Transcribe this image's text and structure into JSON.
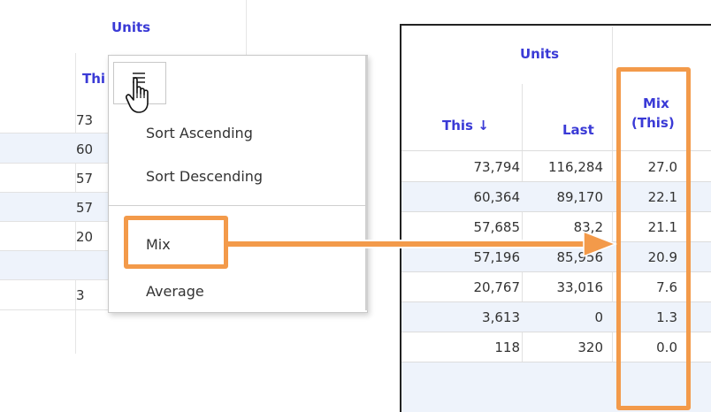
{
  "left_table": {
    "header_units": "Units",
    "header_this": "Thi",
    "rows": [
      "73",
      "60",
      "57",
      "57",
      "20",
      "3"
    ]
  },
  "menu": {
    "icon": "hamburger-icon",
    "items": {
      "sort_asc": "Sort Ascending",
      "sort_desc": "Sort Descending",
      "mix": "Mix",
      "average": "Average"
    }
  },
  "right_table": {
    "header_units": "Units",
    "col_this": "This ↓",
    "col_last": "Last",
    "col_mix_line1": "Mix",
    "col_mix_line2": "(This)",
    "rows": [
      {
        "this": "73,794",
        "last": "116,284",
        "mix": "27.0"
      },
      {
        "this": "60,364",
        "last": "89,170",
        "mix": "22.1"
      },
      {
        "this": "57,685",
        "last": "83,2",
        "mix": "21.1"
      },
      {
        "this": "57,196",
        "last": "85,956",
        "mix": "20.9"
      },
      {
        "this": "20,767",
        "last": "33,016",
        "mix": "7.6"
      },
      {
        "this": "3,613",
        "last": "0",
        "mix": "1.3"
      },
      {
        "this": "118",
        "last": "320",
        "mix": "0.0"
      }
    ]
  },
  "colors": {
    "accent": "#f39a4a",
    "header_blue": "#3a3ad6",
    "row_alt": "#eef3fb"
  }
}
